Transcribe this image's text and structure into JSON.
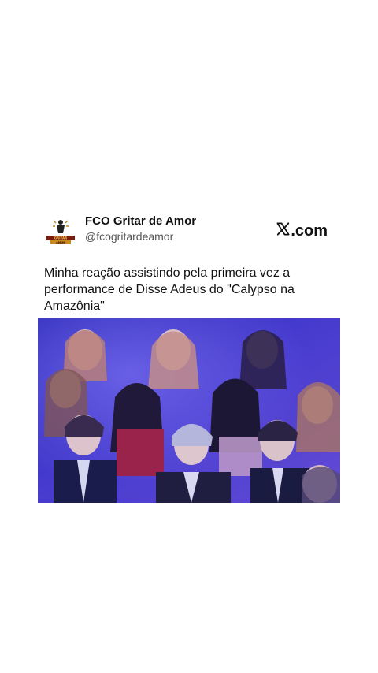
{
  "tweet": {
    "display_name": "FCO Gritar de Amor",
    "handle": "@fcogritardeamor",
    "source": ".com",
    "text": "Minha reação assistindo pela primeira vez a performance de Disse Adeus do \"Calypso na Amazônia\"",
    "avatar_logo_text": "GRITAR DE AMOR"
  },
  "icons": {
    "avatar": "band-logo-icon",
    "source": "x-logo-icon"
  },
  "colors": {
    "background": "#ffffff",
    "text": "#111111",
    "handle": "#555555",
    "media_tint": "#3b2fc0"
  }
}
